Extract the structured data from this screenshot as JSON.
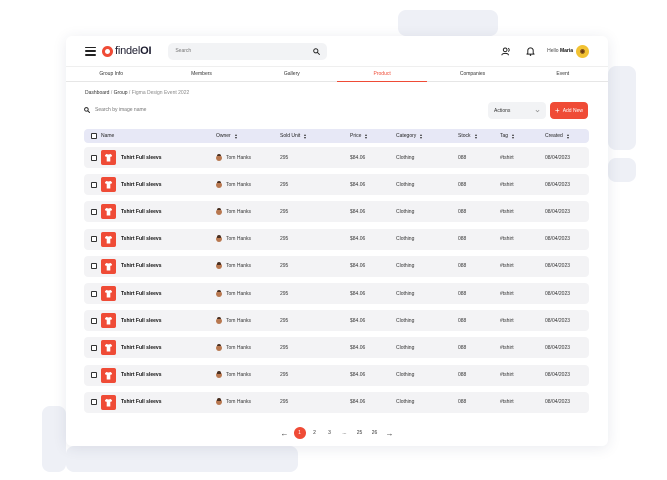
{
  "header": {
    "logo_bold": "findel",
    "logo_rest": "OI",
    "search_placeholder": "Search",
    "greeting": "Hello",
    "user_name": "Maria"
  },
  "tabs": [
    "Group Info",
    "Members",
    "Gallery",
    "Product",
    "Companies",
    "Event"
  ],
  "active_tab": "Product",
  "breadcrumb": {
    "root": "Dashboard",
    "sep1": " / ",
    "group": "Group",
    "sep2": " / ",
    "current": "Figma Design Event 2022"
  },
  "toolbar": {
    "search_placeholder": "Search by image name",
    "actions_label": "Actions",
    "add_new_label": "Add New"
  },
  "table": {
    "columns": [
      "Name",
      "Owner",
      "Sold Unit",
      "Price",
      "Category",
      "Stock",
      "Tag",
      "Created"
    ],
    "rows": [
      {
        "name": "Tshirt Full sleevs",
        "owner": "Tom Hanks",
        "sold": "295",
        "price": "$84.06",
        "category": "Clothing",
        "stock": "088",
        "tag": "#tshirt",
        "created": "08/04/2023"
      },
      {
        "name": "Tshirt Full sleevs",
        "owner": "Tom Hanks",
        "sold": "295",
        "price": "$84.06",
        "category": "Clothing",
        "stock": "088",
        "tag": "#tshirt",
        "created": "08/04/2023"
      },
      {
        "name": "Tshirt Full sleevs",
        "owner": "Tom Hanks",
        "sold": "295",
        "price": "$84.06",
        "category": "Clothing",
        "stock": "088",
        "tag": "#tshirt",
        "created": "08/04/2023"
      },
      {
        "name": "Tshirt Full sleevs",
        "owner": "Tom Hanks",
        "sold": "295",
        "price": "$84.06",
        "category": "Clothing",
        "stock": "088",
        "tag": "#tshirt",
        "created": "08/04/2023"
      },
      {
        "name": "Tshirt Full sleevs",
        "owner": "Tom Hanks",
        "sold": "295",
        "price": "$84.06",
        "category": "Clothing",
        "stock": "088",
        "tag": "#tshirt",
        "created": "08/04/2023"
      },
      {
        "name": "Tshirt Full sleevs",
        "owner": "Tom Hanks",
        "sold": "295",
        "price": "$84.06",
        "category": "Clothing",
        "stock": "088",
        "tag": "#tshirt",
        "created": "08/04/2023"
      },
      {
        "name": "Tshirt Full sleevs",
        "owner": "Tom Hanks",
        "sold": "295",
        "price": "$84.06",
        "category": "Clothing",
        "stock": "088",
        "tag": "#tshirt",
        "created": "08/04/2023"
      },
      {
        "name": "Tshirt Full sleevs",
        "owner": "Tom Hanks",
        "sold": "295",
        "price": "$84.06",
        "category": "Clothing",
        "stock": "088",
        "tag": "#tshirt",
        "created": "08/04/2023"
      },
      {
        "name": "Tshirt Full sleevs",
        "owner": "Tom Hanks",
        "sold": "295",
        "price": "$84.06",
        "category": "Clothing",
        "stock": "088",
        "tag": "#tshirt",
        "created": "08/04/2023"
      },
      {
        "name": "Tshirt Full sleevs",
        "owner": "Tom Hanks",
        "sold": "295",
        "price": "$84.06",
        "category": "Clothing",
        "stock": "088",
        "tag": "#tshirt",
        "created": "08/04/2023"
      }
    ]
  },
  "pagination": {
    "prev_icon": "arrow-left-icon",
    "pages": [
      "1",
      "2",
      "3",
      "...",
      "25",
      "26"
    ],
    "current": "1",
    "next_icon": "arrow-right-icon"
  },
  "colors": {
    "accent": "#ef4b36",
    "header_row": "#e7e8f6",
    "row_bg": "#f3f3f5",
    "deco_bg": "#eef0f6"
  }
}
